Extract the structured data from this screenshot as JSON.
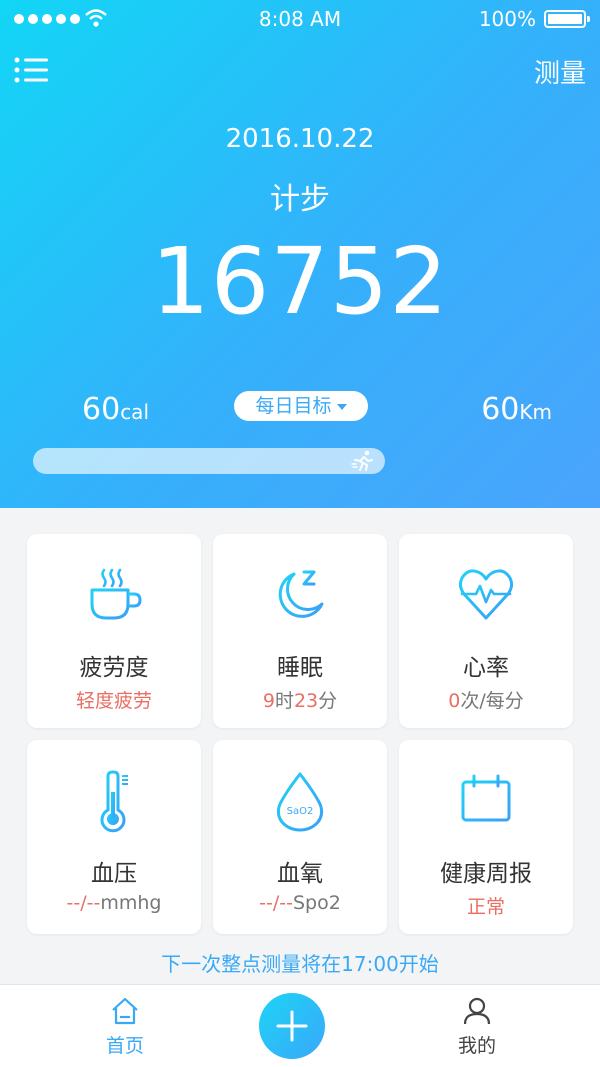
{
  "status": {
    "time": "8:08 AM",
    "battery": "100%"
  },
  "header": {
    "measure_label": "测量"
  },
  "summary": {
    "date": "2016.10.22",
    "metric": "计步",
    "steps": "16752",
    "cal_value": "60",
    "cal_unit": "cal",
    "km_value": "60",
    "km_unit": "Km",
    "goal_label": "每日目标",
    "goal_progress": 1.0
  },
  "cards": [
    {
      "title": "疲劳度",
      "value": "轻度疲劳",
      "icon": "coffee-cup-icon"
    },
    {
      "title": "睡眠",
      "value_h": "9",
      "value_h_unit": "时",
      "value_m": "23",
      "value_m_unit": "分",
      "icon": "moon-sleep-icon"
    },
    {
      "title": "心率",
      "value_num": "0",
      "value_unit": "次/每分",
      "icon": "heart-pulse-icon"
    },
    {
      "title": "血压",
      "value_prefix": "--/--",
      "value_unit": "mmhg",
      "icon": "thermometer-icon"
    },
    {
      "title": "血氧",
      "value_prefix": "--/--",
      "value_unit": "Spo2",
      "icon_text": "SaO2",
      "icon": "drop-icon"
    },
    {
      "title": "健康周报",
      "value": "正常",
      "icon": "calendar-icon"
    }
  ],
  "note": "下一次整点测量将在17:00开始",
  "tabbar": {
    "home": "首页",
    "me": "我的"
  },
  "colors": {
    "accent": "#3aa9f5",
    "alert": "#ea6e63"
  }
}
